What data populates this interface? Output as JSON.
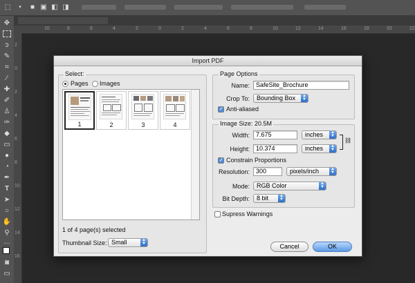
{
  "dialog": {
    "title": "Import PDF",
    "select": {
      "label": "Select:",
      "options": [
        "Pages",
        "Images"
      ],
      "selected_option": "Pages",
      "thumbnails": [
        "1",
        "2",
        "3",
        "4"
      ],
      "selected_thumbnail": "1",
      "status": "1 of 4 page(s) selected",
      "thumbnail_size_label": "Thumbnail Size:",
      "thumbnail_size_value": "Small"
    },
    "page_options": {
      "label": "Page Options",
      "name_label": "Name:",
      "name_value": "SafeSite_Brochure",
      "crop_label": "Crop To:",
      "crop_value": "Bounding Box",
      "anti_aliased_label": "Anti-aliased",
      "anti_aliased_checked": true
    },
    "image_size": {
      "label": "Image Size: 20.5M",
      "width_label": "Width:",
      "width_value": "7.675",
      "width_unit": "inches",
      "height_label": "Height:",
      "height_value": "10.374",
      "height_unit": "inches",
      "constrain_label": "Constrain Proportions",
      "constrain_checked": true,
      "resolution_label": "Resolution:",
      "resolution_value": "300",
      "resolution_unit": "pixels/inch",
      "mode_label": "Mode:",
      "mode_value": "RGB Color",
      "bit_depth_label": "Bit Depth:",
      "bit_depth_value": "8 bit"
    },
    "suppress_warnings_label": "Supress Warnings",
    "suppress_warnings_checked": false,
    "cancel_label": "Cancel",
    "ok_label": "OK"
  },
  "ruler": {
    "h_labels": [
      "10",
      "8",
      "6",
      "4",
      "2",
      "0",
      "2",
      "4",
      "6",
      "8",
      "10",
      "12",
      "14",
      "16",
      "18",
      "20",
      "22"
    ],
    "v_labels": [
      "2",
      "0",
      "2",
      "4",
      "6",
      "8",
      "10",
      "12",
      "14",
      "16"
    ]
  },
  "toolbox_icons": [
    "move-icon",
    "marquee-icon",
    "lasso-icon",
    "quick-select-icon",
    "crop-icon",
    "eyedropper-icon",
    "healing-icon",
    "brush-icon",
    "stamp-icon",
    "history-brush-icon",
    "eraser-icon",
    "gradient-icon",
    "blur-icon",
    "dodge-icon",
    "pen-icon",
    "type-icon",
    "path-select-icon",
    "shape-icon",
    "hand-icon",
    "zoom-icon",
    "more-icon",
    "color-swatch-icon",
    "quick-mask-icon",
    "screen-mode-icon"
  ]
}
